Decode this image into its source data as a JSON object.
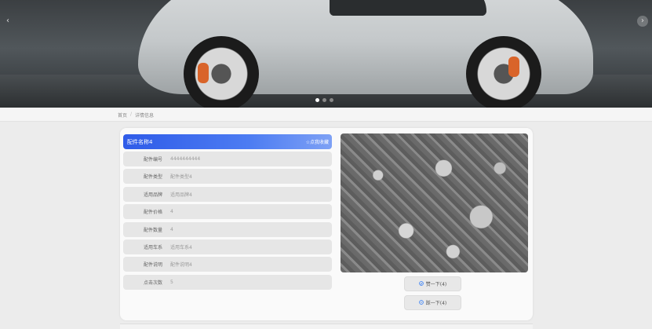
{
  "banner": {
    "prev_icon": "‹",
    "next_icon": "›",
    "slides": 3,
    "active_slide": 1
  },
  "breadcrumb": {
    "home": "首页",
    "separator": "/",
    "current": "详情信息"
  },
  "detail": {
    "title": "配件名称4",
    "favorite": "☆点我收藏",
    "fields": [
      {
        "label": "配件编号",
        "value": "4444444444"
      },
      {
        "label": "配件类型",
        "value": "配件类型4"
      },
      {
        "label": "适用品牌",
        "value": "适用品牌4"
      },
      {
        "label": "配件价格",
        "value": "4"
      },
      {
        "label": "配件数量",
        "value": "4"
      },
      {
        "label": "适用车系",
        "value": "适用车系4"
      },
      {
        "label": "配件说明",
        "value": "配件说明4"
      },
      {
        "label": "点击次数",
        "value": "5"
      }
    ]
  },
  "actions": {
    "like": "赞一下(4)",
    "dislike": "踩一下(4)",
    "like_icon": "thumbs-up-icon",
    "dislike_icon": "thumbs-down-icon"
  }
}
